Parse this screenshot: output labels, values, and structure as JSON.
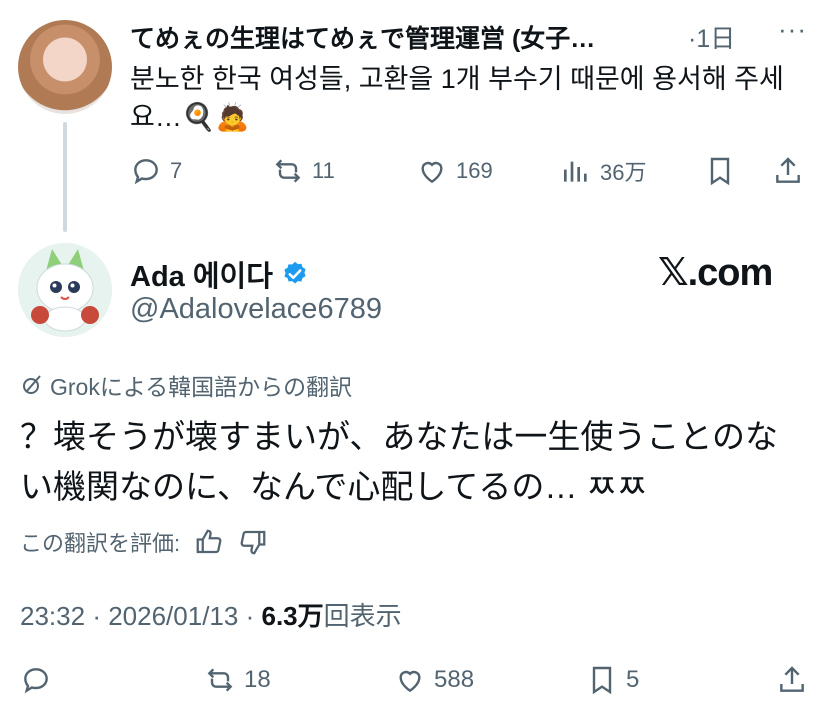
{
  "tweet1": {
    "author_name": "てめぇの生理はてめぇで管理運営 (女子…",
    "time": "·1日",
    "more": "···",
    "text": "분노한 한국 여성들, 고환을 1개 부수기 때문에 용서해 주세요…🍳🙇",
    "actions": {
      "replies": "7",
      "reposts": "11",
      "likes": "169",
      "views": "36万"
    }
  },
  "tweet2": {
    "author_name": "Ada 에이다",
    "handle": "@Adalovelace6789",
    "watermark": "𝕏.com",
    "translation_label": "Grokによる韓国語からの翻訳",
    "text": "？壊そうが壊すまいが、あなたは一生使うことのない機関なのに、なんで心配してるの… ㅉㅉ",
    "rate_label": "この翻訳を評価:",
    "meta": {
      "time": "23:32",
      "date": "2026/01/13",
      "views": "6.3万",
      "views_suffix": "回表示",
      "sep": "·"
    },
    "actions": {
      "replies": "",
      "reposts": "18",
      "likes": "588",
      "bookmarks": "5"
    }
  },
  "colors": {
    "text": "#0f1419",
    "secondary": "#536471",
    "verified": "#1d9bf0",
    "thread_line": "#cfd9de"
  }
}
